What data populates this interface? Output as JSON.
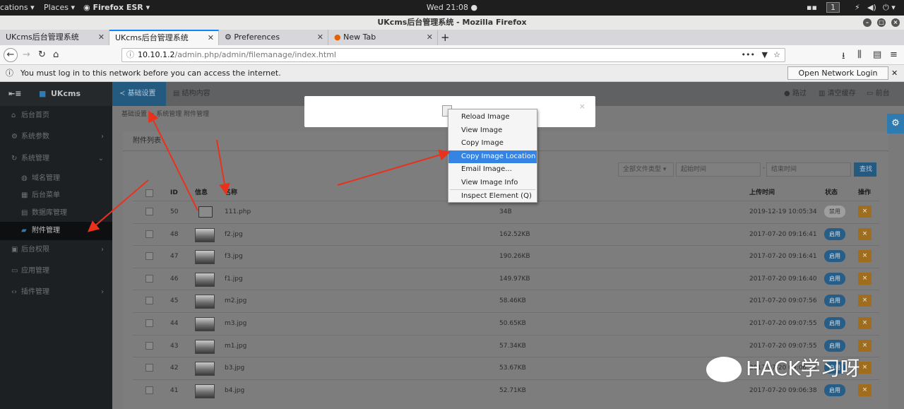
{
  "gnome": {
    "applications": "cations ▾",
    "places": "Places ▾",
    "app": "Firefox ESR ▾",
    "clock": "Wed 21:08 ●",
    "workspace": "1"
  },
  "window": {
    "title": "UKcms后台管理系统 - Mozilla Firefox"
  },
  "tabs": [
    {
      "label": "UKcms后台管理系统"
    },
    {
      "label": "UKcms后台管理系统"
    },
    {
      "label": "Preferences"
    },
    {
      "label": "New Tab"
    }
  ],
  "url": {
    "host": "10.10.1.2",
    "path": "/admin.php/admin/filemanage/index.html"
  },
  "notification": {
    "text": "You must log in to this network before you can access the internet.",
    "button": "Open Network Login Page"
  },
  "cms": {
    "brand": "UKcms",
    "topnav": [
      {
        "label": "基础设置"
      },
      {
        "label": "结构内容"
      }
    ],
    "top_right": [
      {
        "label": "路过"
      },
      {
        "label": "清空缓存"
      },
      {
        "label": "前台"
      }
    ],
    "sidebar": [
      {
        "label": "后台首页",
        "icon": "home-icon"
      },
      {
        "label": "系统参数",
        "icon": "gears-icon"
      },
      {
        "label": "系统管理",
        "icon": "sync-icon"
      },
      {
        "label": "域名管理",
        "icon": "globe-icon"
      },
      {
        "label": "后台菜单",
        "icon": "menu-icon"
      },
      {
        "label": "数据库管理",
        "icon": "database-icon"
      },
      {
        "label": "附件管理",
        "icon": "folder-icon"
      },
      {
        "label": "后台权限",
        "icon": "lock-icon"
      },
      {
        "label": "应用管理",
        "icon": "app-icon"
      },
      {
        "label": "插件管理",
        "icon": "code-icon"
      }
    ],
    "breadcrumb": "基础设置 > 系统管理  附件管理",
    "panel_title": "附件列表",
    "filters": {
      "type": "全部文件类型 ▾",
      "start_placeholder": "起始时间",
      "end_placeholder": "结束时间",
      "search_button": "查找",
      "separator": "-"
    },
    "columns": {
      "id": "ID",
      "info": "信息",
      "name": "名称",
      "size": "",
      "time": "上传时间",
      "status": "状态",
      "action": "操作"
    },
    "rows": [
      {
        "id": "50",
        "name": "111.php",
        "size": "34B",
        "time": "2019-12-19 10:05:34",
        "status": "禁用",
        "enabled": false,
        "thumb": "file"
      },
      {
        "id": "48",
        "name": "f2.jpg",
        "size": "162.52KB",
        "time": "2017-07-20 09:16:41",
        "status": "启用",
        "enabled": true
      },
      {
        "id": "47",
        "name": "f3.jpg",
        "size": "190.26KB",
        "time": "2017-07-20 09:16:41",
        "status": "启用",
        "enabled": true
      },
      {
        "id": "46",
        "name": "f1.jpg",
        "size": "149.97KB",
        "time": "2017-07-20 09:16:40",
        "status": "启用",
        "enabled": true
      },
      {
        "id": "45",
        "name": "m2.jpg",
        "size": "58.46KB",
        "time": "2017-07-20 09:07:56",
        "status": "启用",
        "enabled": true
      },
      {
        "id": "44",
        "name": "m3.jpg",
        "size": "50.65KB",
        "time": "2017-07-20 09:07:55",
        "status": "启用",
        "enabled": true
      },
      {
        "id": "43",
        "name": "m1.jpg",
        "size": "57.34KB",
        "time": "2017-07-20 09:07:55",
        "status": "启用",
        "enabled": true
      },
      {
        "id": "42",
        "name": "b3.jpg",
        "size": "53.67KB",
        "time": "2017-07-20 09:06:38",
        "status": "启用",
        "enabled": true
      },
      {
        "id": "41",
        "name": "b4.jpg",
        "size": "52.71KB",
        "time": "2017-07-20 09:06:38",
        "status": "启用",
        "enabled": true
      }
    ],
    "delete_glyph": "×"
  },
  "context_menu": [
    {
      "label": "Reload Image"
    },
    {
      "label": "View Image"
    },
    {
      "label": "Copy Image"
    },
    {
      "label": "Copy Image Location",
      "highlighted": true
    },
    {
      "label": "Email Image..."
    },
    {
      "label": "View Image Info"
    },
    {
      "label": "Inspect Element (Q)"
    }
  ],
  "watermark": "HACK学习呀",
  "colors": {
    "accent": "#2d7bb0",
    "highlight": "#3584e4",
    "arrow": "#e8321e",
    "delete": "#a06d1d"
  }
}
